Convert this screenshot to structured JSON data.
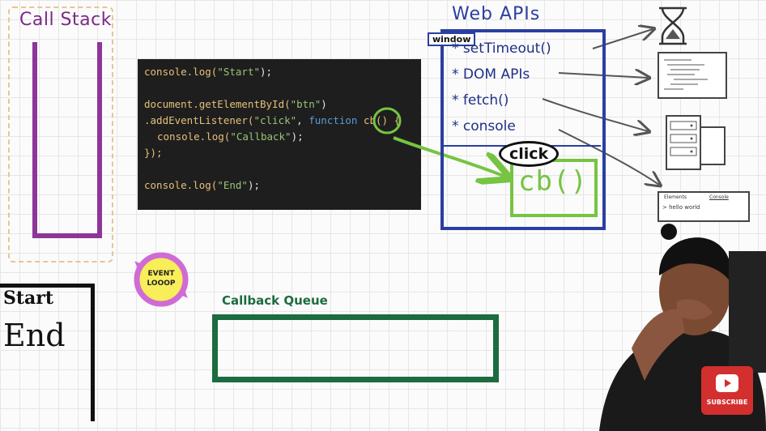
{
  "call_stack": {
    "title": "Call Stack"
  },
  "code": {
    "line1": {
      "fn": "console.log(",
      "str": "\"Start\"",
      "end": ");"
    },
    "line2": {
      "fn": "document.getElementById(",
      "str": "\"btn\"",
      "end": ")"
    },
    "line3": {
      "fn": ".addEventListener(",
      "str": "\"click\"",
      "sep": ", ",
      "kw": "function",
      "name": "cb",
      "paren": "()",
      "brace": "{"
    },
    "line4": {
      "fn": "console.log(",
      "str": "\"Callback\"",
      "end": ");"
    },
    "line5": {
      "close": "});"
    },
    "line6": {
      "fn": "console.log(",
      "str": "\"End\"",
      "end": ");"
    }
  },
  "web_apis": {
    "title": "Web APIs",
    "window_label": "window",
    "items": [
      "* setTimeout()",
      "* DOM APIs",
      "* fetch()",
      "* console"
    ],
    "click_label": "click",
    "callback_label": "cb()"
  },
  "output": {
    "lines": [
      "Start",
      "End"
    ]
  },
  "event_loop": {
    "label_line1": "EVENT",
    "label_line2": "LOOOP"
  },
  "callback_queue": {
    "title": "Callback Queue"
  },
  "devtools": {
    "tabs": [
      "Elements",
      "Console"
    ],
    "output_text": "> hello world"
  },
  "subscribe": {
    "label": "SUBSCRIBE"
  },
  "colors": {
    "call_stack": "#8e3598",
    "web_apis": "#2a3fa0",
    "callback": "#76c442",
    "queue": "#1d6b40",
    "subscribe": "#d32f2f"
  }
}
